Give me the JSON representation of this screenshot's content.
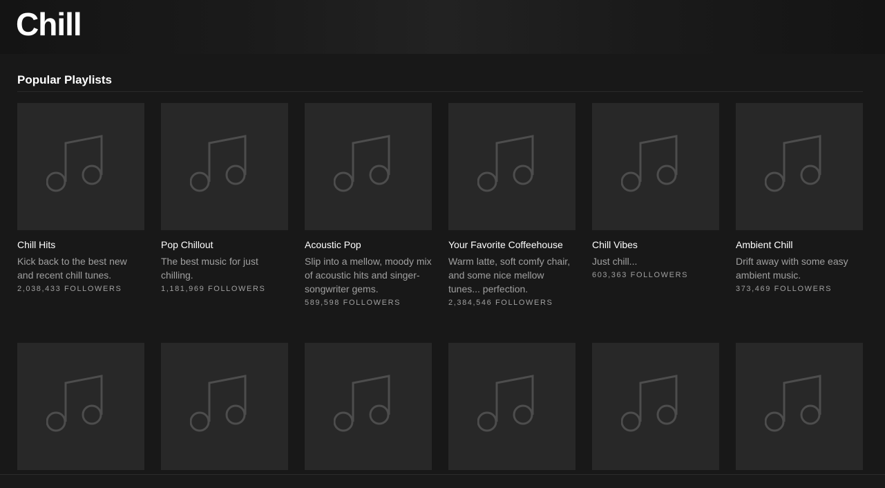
{
  "header": {
    "title": "Chill"
  },
  "section": {
    "title": "Popular Playlists"
  },
  "playlists": [
    {
      "title": "Chill Hits",
      "description": "Kick back to the best new and recent chill tunes.",
      "followers": "2,038,433 FOLLOWERS"
    },
    {
      "title": "Pop Chillout",
      "description": "The best music for just chilling.",
      "followers": "1,181,969 FOLLOWERS"
    },
    {
      "title": "Acoustic Pop",
      "description": "Slip into a mellow, moody mix of acoustic hits and singer-songwriter gems.",
      "followers": "589,598 FOLLOWERS"
    },
    {
      "title": "Your Favorite Coffeehouse",
      "description": "Warm latte, soft comfy chair, and some nice mellow tunes... perfection.",
      "followers": "2,384,546 FOLLOWERS"
    },
    {
      "title": "Chill Vibes",
      "description": "Just chill...",
      "followers": "603,363 FOLLOWERS"
    },
    {
      "title": "Ambient Chill",
      "description": "Drift away with some easy ambient music.",
      "followers": "373,469 FOLLOWERS"
    }
  ],
  "cover_icon": "music-note-icon",
  "colors": {
    "background": "#181818",
    "cover": "#282828",
    "icon": "#4d4d4d",
    "text_primary": "#ffffff",
    "text_secondary": "#a0a0a0"
  }
}
